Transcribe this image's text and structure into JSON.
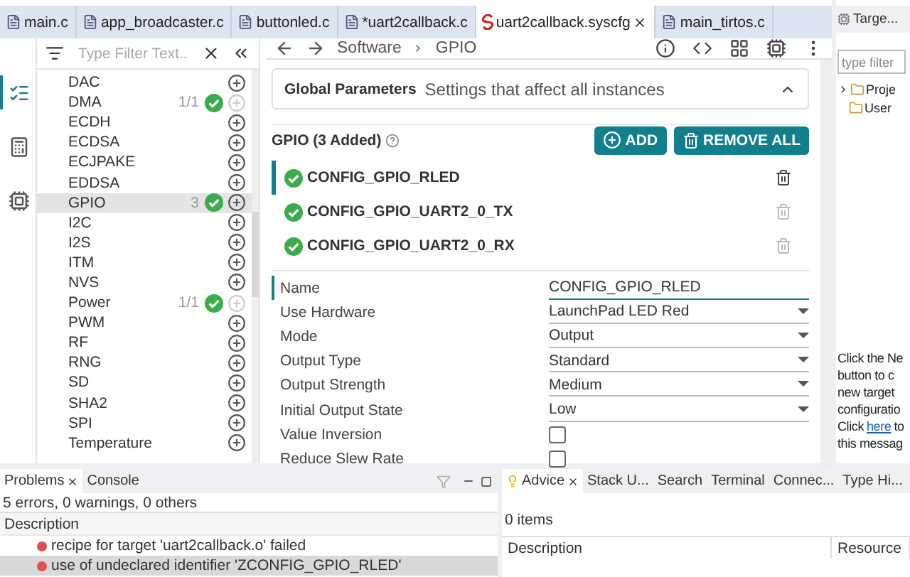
{
  "editor_tabs": [
    {
      "label": "main.c",
      "kind": "c",
      "selected": false,
      "closable": false
    },
    {
      "label": "app_broadcaster.c",
      "kind": "c",
      "selected": false,
      "closable": false
    },
    {
      "label": "buttonled.c",
      "kind": "c",
      "selected": false,
      "closable": false
    },
    {
      "label": "*uart2callback.c",
      "kind": "c",
      "selected": false,
      "closable": false
    },
    {
      "label": "uart2callback.syscfg",
      "kind": "syscfg",
      "selected": true,
      "closable": true
    },
    {
      "label": "main_tirtos.c",
      "kind": "c",
      "selected": false,
      "closable": false
    }
  ],
  "side_views": [
    {
      "kind": "list",
      "selected": true
    },
    {
      "kind": "calculator",
      "selected": false
    },
    {
      "kind": "chip",
      "selected": false
    }
  ],
  "filter": {
    "placeholder": "Type Filter Text..."
  },
  "modules": [
    {
      "name": "DAC",
      "added": false,
      "disabled": false,
      "selected": false
    },
    {
      "name": "DMA",
      "count": "1/1",
      "added": true,
      "disabled": true,
      "selected": false
    },
    {
      "name": "ECDH",
      "added": false,
      "disabled": false,
      "selected": false
    },
    {
      "name": "ECDSA",
      "added": false,
      "disabled": false,
      "selected": false
    },
    {
      "name": "ECJPAKE",
      "added": false,
      "disabled": false,
      "selected": false
    },
    {
      "name": "EDDSA",
      "added": false,
      "disabled": false,
      "selected": false
    },
    {
      "name": "GPIO",
      "count": "3",
      "added": true,
      "disabled": false,
      "selected": true
    },
    {
      "name": "I2C",
      "added": false,
      "disabled": false,
      "selected": false
    },
    {
      "name": "I2S",
      "added": false,
      "disabled": false,
      "selected": false
    },
    {
      "name": "ITM",
      "added": false,
      "disabled": false,
      "selected": false
    },
    {
      "name": "NVS",
      "added": false,
      "disabled": false,
      "selected": false
    },
    {
      "name": "Power",
      "count": "1/1",
      "added": true,
      "disabled": true,
      "selected": false
    },
    {
      "name": "PWM",
      "added": false,
      "disabled": false,
      "selected": false
    },
    {
      "name": "RF",
      "added": false,
      "disabled": false,
      "selected": false
    },
    {
      "name": "RNG",
      "added": false,
      "disabled": false,
      "selected": false
    },
    {
      "name": "SD",
      "added": false,
      "disabled": false,
      "selected": false
    },
    {
      "name": "SHA2",
      "added": false,
      "disabled": false,
      "selected": false
    },
    {
      "name": "SPI",
      "added": false,
      "disabled": false,
      "selected": false
    },
    {
      "name": "Temperature",
      "added": false,
      "disabled": false,
      "selected": false
    }
  ],
  "breadcrumb": [
    "Software",
    "GPIO"
  ],
  "global_parameters": {
    "title": "Global Parameters",
    "description": "Settings that affect all instances",
    "expanded": true
  },
  "gpio": {
    "title": "GPIO (3 Added)",
    "buttons": [
      {
        "label": "ADD",
        "kind": "add"
      },
      {
        "label": "REMOVE ALL",
        "kind": "remove"
      }
    ],
    "instances": [
      {
        "name": "CONFIG_GPIO_RLED",
        "selected": true
      },
      {
        "name": "CONFIG_GPIO_UART2_0_TX",
        "selected": false
      },
      {
        "name": "CONFIG_GPIO_UART2_0_RX",
        "selected": false
      }
    ]
  },
  "properties": [
    {
      "label": "Name",
      "kind": "text",
      "value": "CONFIG_GPIO_RLED"
    },
    {
      "label": "Use Hardware",
      "kind": "select",
      "value": "LaunchPad LED Red"
    },
    {
      "label": "Mode",
      "kind": "select",
      "value": "Output"
    },
    {
      "label": "Output Type",
      "kind": "select",
      "value": "Standard"
    },
    {
      "label": "Output Strength",
      "kind": "select",
      "value": "Medium"
    },
    {
      "label": "Initial Output State",
      "kind": "select",
      "value": "Low"
    },
    {
      "label": "Value Inversion",
      "kind": "checkbox",
      "checked": false
    },
    {
      "label": "Reduce Slew Rate",
      "kind": "checkbox",
      "checked": false
    }
  ],
  "target_view": {
    "tab": "Targe...",
    "filter_placeholder": "type filter",
    "tree": [
      {
        "label": "Proje",
        "expandable": true
      },
      {
        "label": "User",
        "expandable": false
      }
    ],
    "message_lines": [
      "Click the Ne",
      "button to c",
      "new target",
      "configuratio"
    ],
    "link_line": {
      "before": "Click",
      "link": "here",
      "after": "to"
    },
    "last_line": "this messag"
  },
  "problems": {
    "tabs": [
      {
        "label": "Problems",
        "selected": true
      },
      {
        "label": "Console",
        "selected": false
      }
    ],
    "summary": "5 errors, 0 warnings, 0 others",
    "column": "Description",
    "rows": [
      {
        "text": "recipe for target 'uart2callback.o' failed",
        "selected": false
      },
      {
        "text": "use of undeclared identifier 'ZCONFIG_GPIO_RLED'",
        "selected": true
      }
    ]
  },
  "advice": {
    "tabs": [
      {
        "label": "Advice",
        "selected": true
      },
      {
        "label": "Stack U...",
        "selected": false
      },
      {
        "label": "Search",
        "selected": false
      },
      {
        "label": "Terminal",
        "selected": false
      },
      {
        "label": "Connec...",
        "selected": false
      },
      {
        "label": "Type Hi...",
        "selected": false
      }
    ],
    "summary": "0 items",
    "columns": [
      "Description",
      "Resource"
    ]
  }
}
